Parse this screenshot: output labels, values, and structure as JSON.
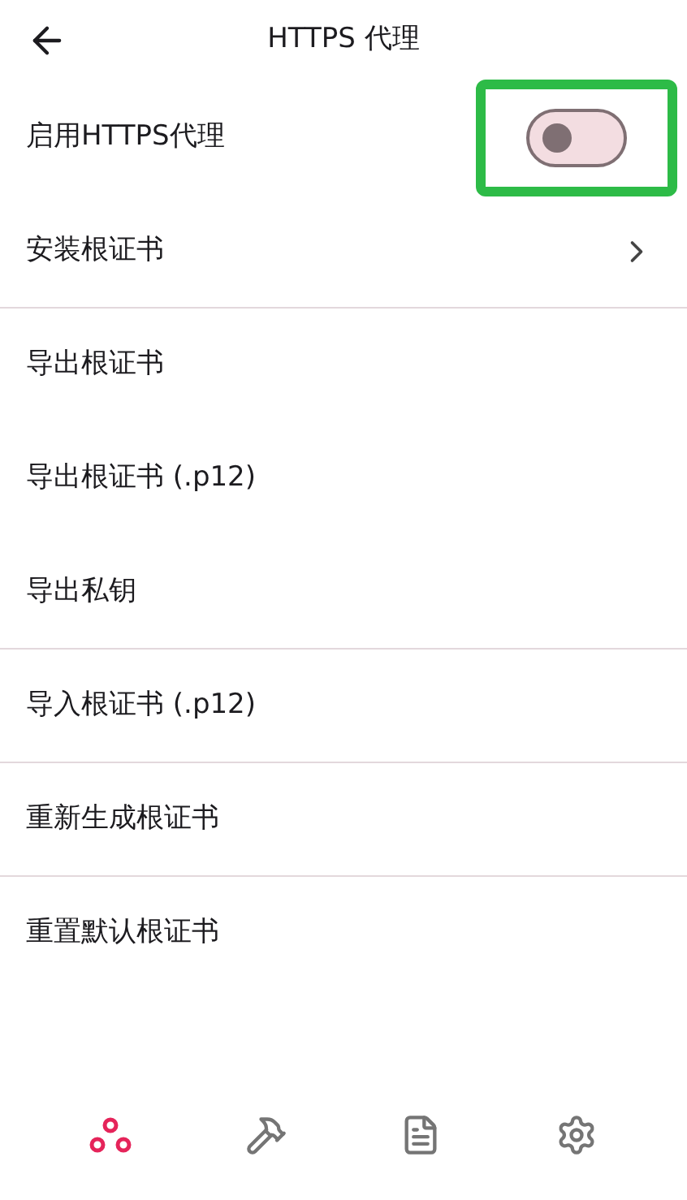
{
  "header": {
    "title": "HTTPS 代理"
  },
  "rows": [
    {
      "kind": "switch",
      "label": "启用HTTPS代理",
      "on": false,
      "divider_after": false
    },
    {
      "kind": "link",
      "label": "安装根证书",
      "divider_after": true
    },
    {
      "kind": "plain",
      "label": "导出根证书",
      "divider_after": false
    },
    {
      "kind": "plain",
      "label": "导出根证书 (.p12)",
      "divider_after": false
    },
    {
      "kind": "plain",
      "label": "导出私钥",
      "divider_after": true
    },
    {
      "kind": "plain",
      "label": "导入根证书 (.p12)",
      "divider_after": true
    },
    {
      "kind": "plain",
      "label": "重新生成根证书",
      "divider_after": true
    },
    {
      "kind": "plain",
      "label": "重置默认根证书",
      "divider_after": false
    }
  ],
  "bottom_nav": [
    {
      "kind": "network",
      "selected": true
    },
    {
      "kind": "tools",
      "selected": false
    },
    {
      "kind": "document",
      "selected": false
    },
    {
      "kind": "settings",
      "selected": false
    }
  ]
}
